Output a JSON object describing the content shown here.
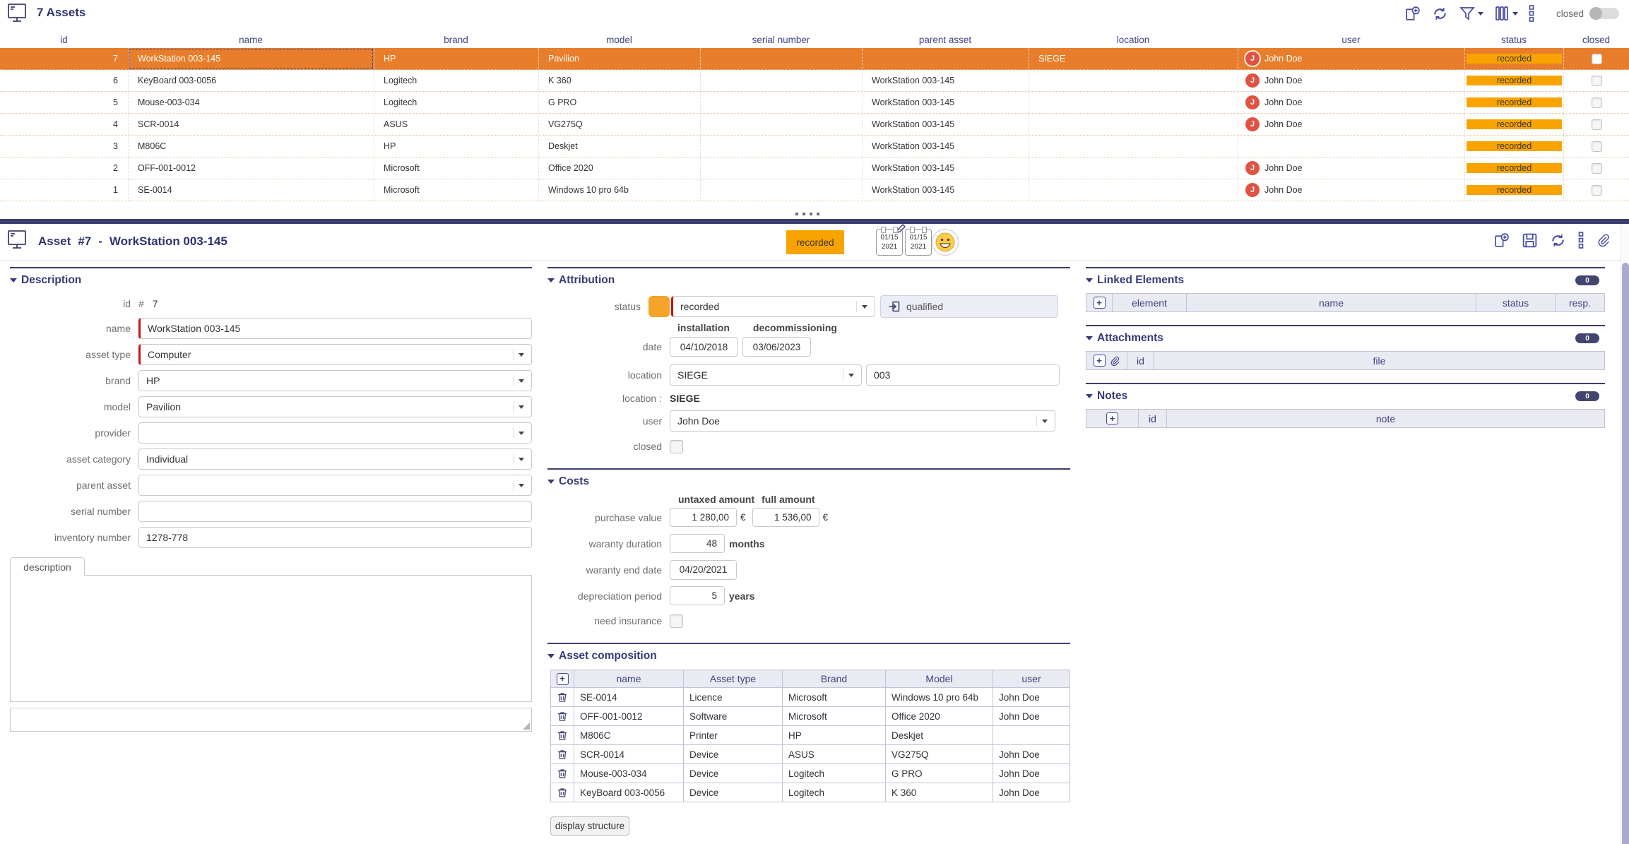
{
  "colors": {
    "accent_orange": "#f9a300",
    "selected_row": "#e87e2c",
    "navy": "#3b3e6e",
    "avatar_red": "#e25141"
  },
  "list": {
    "title": "7 Assets",
    "avatar_initial": "J",
    "toolbar": {
      "closed_label": "closed"
    },
    "columns": [
      "id",
      "name",
      "brand",
      "model",
      "serial number",
      "parent asset",
      "location",
      "user",
      "status",
      "closed"
    ],
    "rows": [
      {
        "id": "7",
        "name": "WorkStation 003-145",
        "brand": "HP",
        "model": "Pavilion",
        "serial_number": "",
        "parent_asset": "",
        "location": "SIEGE",
        "user": "John Doe",
        "status": "recorded"
      },
      {
        "id": "6",
        "name": "KeyBoard 003-0056",
        "brand": "Logitech",
        "model": "K 360",
        "serial_number": "",
        "parent_asset": "WorkStation 003-145",
        "location": "",
        "user": "John Doe",
        "status": "recorded"
      },
      {
        "id": "5",
        "name": "Mouse-003-034",
        "brand": "Logitech",
        "model": "G PRO",
        "serial_number": "",
        "parent_asset": "WorkStation 003-145",
        "location": "",
        "user": "John Doe",
        "status": "recorded"
      },
      {
        "id": "4",
        "name": "SCR-0014",
        "brand": "ASUS",
        "model": "VG275Q",
        "serial_number": "",
        "parent_asset": "WorkStation 003-145",
        "location": "",
        "user": "John Doe",
        "status": "recorded"
      },
      {
        "id": "3",
        "name": "M806C",
        "brand": "HP",
        "model": "Deskjet",
        "serial_number": "",
        "parent_asset": "WorkStation 003-145",
        "location": "",
        "user": "",
        "status": "recorded"
      },
      {
        "id": "2",
        "name": "OFF-001-0012",
        "brand": "Microsoft",
        "model": "Office 2020",
        "serial_number": "",
        "parent_asset": "WorkStation 003-145",
        "location": "",
        "user": "John Doe",
        "status": "recorded"
      },
      {
        "id": "1",
        "name": "SE-0014",
        "brand": "Microsoft",
        "model": "Windows 10 pro 64b",
        "serial_number": "",
        "parent_asset": "WorkStation 003-145",
        "location": "",
        "user": "John Doe",
        "status": "recorded"
      }
    ]
  },
  "detail": {
    "entity": "Asset",
    "number": "#7",
    "separator": "-",
    "name": "WorkStation 003-145",
    "status_badge": "recorded",
    "modified_stamp": {
      "line1": "01/15",
      "line2": "2021"
    },
    "created_stamp": {
      "line1": "01/15",
      "line2": "2021"
    },
    "description": {
      "title": "Description",
      "id": {
        "label": "id",
        "hash": "#",
        "value": "7"
      },
      "name": {
        "label": "name",
        "value": "WorkStation 003-145"
      },
      "asset_type": {
        "label": "asset type",
        "value": "Computer"
      },
      "brand": {
        "label": "brand",
        "value": "HP"
      },
      "model": {
        "label": "model",
        "value": "Pavilion"
      },
      "provider": {
        "label": "provider",
        "value": ""
      },
      "asset_category": {
        "label": "asset category",
        "value": "Individual"
      },
      "parent_asset": {
        "label": "parent asset",
        "value": ""
      },
      "serial_number": {
        "label": "serial number",
        "value": ""
      },
      "inventory_number": {
        "label": "inventory number",
        "value": "1278-778"
      },
      "tab_label": "description",
      "description_text": ""
    },
    "attribution": {
      "title": "Attribution",
      "status_label": "status",
      "status_value": "recorded",
      "qualified_button": "qualified",
      "installation_label": "installation",
      "decommissioning_label": "decommissioning",
      "date_label": "date",
      "installation_date": "04/10/2018",
      "decommissioning_date": "03/06/2023",
      "location_label": "location",
      "location_value": "SIEGE",
      "location_unit": "003",
      "location_static_label": "location :",
      "location_static_value": "SIEGE",
      "user_label": "user",
      "user_value": "John Doe",
      "closed_label": "closed"
    },
    "costs": {
      "title": "Costs",
      "untaxed_header": "untaxed amount",
      "full_header": "full amount",
      "purchase_label": "purchase value",
      "purchase_untaxed": "1 280,00",
      "purchase_full": "1 536,00",
      "currency": "€",
      "waranty_duration_label": "waranty duration",
      "waranty_duration_value": "48",
      "waranty_duration_unit": "months",
      "waranty_end_label": "waranty end date",
      "waranty_end_value": "04/20/2021",
      "depreciation_label": "depreciation period",
      "depreciation_value": "5",
      "depreciation_unit": "years",
      "need_insurance_label": "need insurance"
    },
    "composition": {
      "title": "Asset composition",
      "columns": [
        "name",
        "Asset type",
        "Brand",
        "Model",
        "user"
      ],
      "rows": [
        {
          "name": "SE-0014",
          "type": "Licence",
          "brand": "Microsoft",
          "model": "Windows 10 pro 64b",
          "user": "John Doe"
        },
        {
          "name": "OFF-001-0012",
          "type": "Software",
          "brand": "Microsoft",
          "model": "Office 2020",
          "user": "John Doe"
        },
        {
          "name": "M806C",
          "type": "Printer",
          "brand": "HP",
          "model": "Deskjet",
          "user": ""
        },
        {
          "name": "SCR-0014",
          "type": "Device",
          "brand": "ASUS",
          "model": "VG275Q",
          "user": "John Doe"
        },
        {
          "name": "Mouse-003-034",
          "type": "Device",
          "brand": "Logitech",
          "model": "G PRO",
          "user": "John Doe"
        },
        {
          "name": "KeyBoard 003-0056",
          "type": "Device",
          "brand": "Logitech",
          "model": "K 360",
          "user": "John Doe"
        }
      ],
      "display_structure_label": "display structure"
    },
    "linked_elements": {
      "title": "Linked Elements",
      "count": "0",
      "columns": [
        "element",
        "name",
        "status",
        "resp."
      ]
    },
    "attachments": {
      "title": "Attachments",
      "count": "0",
      "columns": [
        "id",
        "file"
      ]
    },
    "notes": {
      "title": "Notes",
      "count": "0",
      "columns": [
        "id",
        "note"
      ]
    }
  }
}
